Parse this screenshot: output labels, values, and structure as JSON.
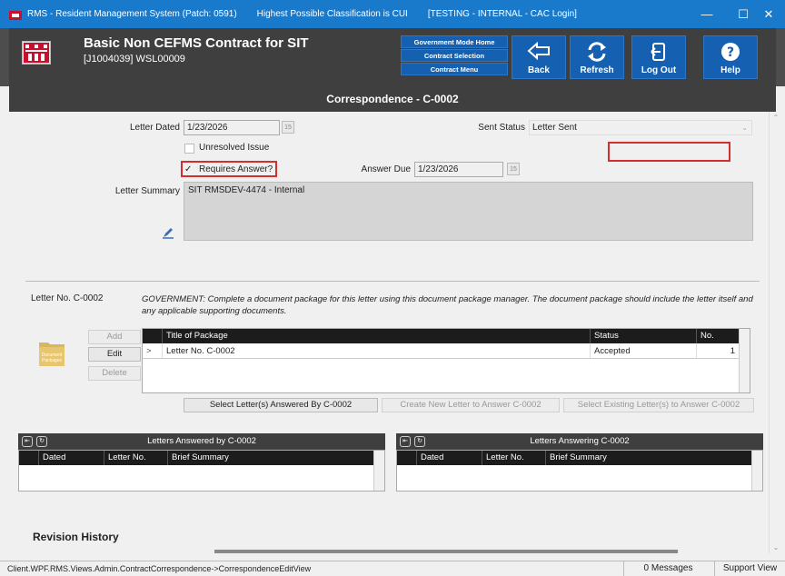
{
  "titlebar": {
    "app": "RMS - Resident Management System (Patch: 0591)",
    "classification": "Highest Possible Classification is CUI",
    "env": "[TESTING - INTERNAL - CAC Login]",
    "minimize": "—",
    "maximize": "☐",
    "close": "✕",
    "color": "#1979ca"
  },
  "header": {
    "title": "Basic Non CEFMS Contract for SIT",
    "subtitle": "[J1004039] WSL00009",
    "nav": [
      "Government Mode Home",
      "Contract Selection",
      "Contract Menu"
    ],
    "back": "Back",
    "refresh": "Refresh",
    "logout": "Log Out",
    "help": "Help",
    "button_color": "#1560b0"
  },
  "section_title": "Correspondence - C-0002",
  "form": {
    "letter_dated_label": "Letter Dated",
    "letter_dated": "1/23/2026",
    "sent_status_label": "Sent Status",
    "sent_status": "Letter Sent",
    "unresolved_label": "Unresolved Issue",
    "requires_answer_label": "Requires Answer?",
    "requires_answer_check": "✓",
    "answer_due_label": "Answer Due",
    "answer_due": "1/23/2026",
    "summary_label": "Letter Summary",
    "summary": "SIT RMSDEV-4474 - Internal",
    "calendar_day": "15"
  },
  "package": {
    "letter_no_label": "Letter No. C-0002",
    "instruction": "GOVERNMENT: Complete a document package for this letter using this document package manager. The document package should include the letter itself and any applicable supporting documents.",
    "add": "Add",
    "edit": "Edit",
    "delete": "Delete",
    "folder_label_1": "Document",
    "folder_label_2": "Packages",
    "columns": [
      "Title of Package",
      "Status",
      "No."
    ],
    "rows": [
      {
        "marker": ">",
        "title": "Letter No. C-0002",
        "status": "Accepted",
        "no": "1"
      }
    ]
  },
  "actions": {
    "select_answered": "Select Letter(s) Answered By C-0002",
    "create_new": "Create New Letter to Answer C-0002",
    "select_existing": "Select Existing Letter(s) to Answer C-0002"
  },
  "panes": {
    "left_title": "Letters Answered by C-0002",
    "right_title": "Letters Answering C-0002",
    "columns": [
      "Dated",
      "Letter No.",
      "Brief Summary"
    ]
  },
  "revision_history": "Revision History",
  "statusbar": {
    "path": "Client.WPF.RMS.Views.Admin.ContractCorrespondence->CorrespondenceEditView",
    "messages": "0 Messages",
    "support": "Support View"
  },
  "icons": {
    "app": "usace-castle-icon",
    "back": "arrow-left-icon",
    "refresh": "refresh-icon",
    "logout": "logout-icon",
    "help": "help-icon"
  }
}
